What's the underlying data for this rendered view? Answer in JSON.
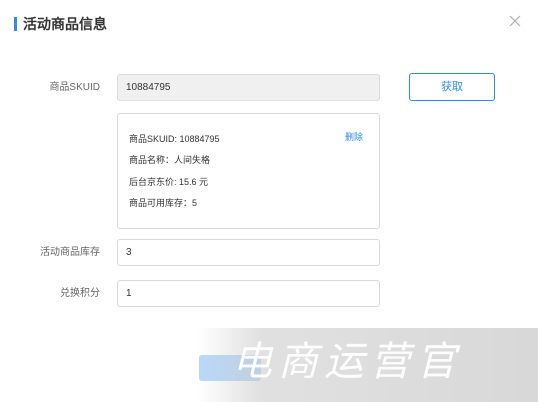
{
  "dialog": {
    "title": "活动商品信息",
    "close_icon": "close-icon"
  },
  "form": {
    "sku_label": "商品SKUID",
    "sku_value": "10884795",
    "fetch_button": "获取",
    "stock_label": "活动商品库存",
    "stock_value": "3",
    "points_label": "兑换积分",
    "points_value": "1"
  },
  "product_info": {
    "sku_line": "商品SKUID: 10884795",
    "name_line": "商品名称：人间失格",
    "price_line": "后台京东价: 15.6 元",
    "stock_line": "商品可用库存：5",
    "delete_link": "删除"
  },
  "watermark": {
    "text": "电商运营官"
  },
  "colors": {
    "accent": "#2d8cf0",
    "border": "#d9d9d9"
  }
}
